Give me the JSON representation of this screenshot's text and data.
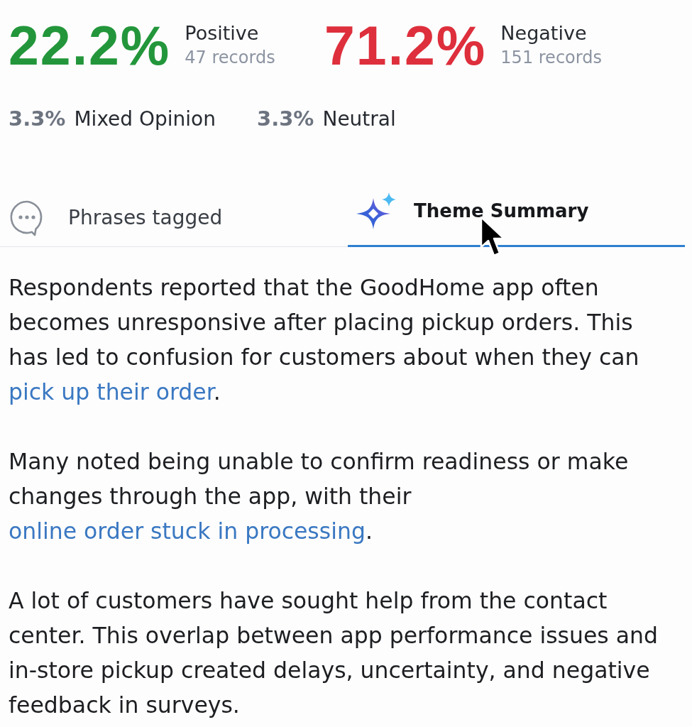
{
  "metrics": [
    {
      "value": "22.2%",
      "color": "#23963b",
      "label": "Positive",
      "records": "47 records"
    },
    {
      "value": "71.2%",
      "color": "#de2f3c",
      "label": "Negative",
      "records": "151 records"
    }
  ],
  "minor_metrics": [
    {
      "value": "3.3%",
      "label": "Mixed Opinion"
    },
    {
      "value": "3.3%",
      "label": "Neutral"
    }
  ],
  "tabs": [
    {
      "kind": "chat",
      "label": "Phrases tagged",
      "selected": false
    },
    {
      "kind": "sparkle",
      "label": "Theme Summary",
      "selected": true
    }
  ],
  "summary": [
    [
      {
        "kind": "text",
        "text": "Respondents reported that the GoodHome app often becomes unresponsive after placing pickup orders. This has led to confusion for customers about when they can "
      },
      {
        "kind": "link",
        "text": "pick up their order"
      },
      {
        "kind": "text",
        "text": "."
      }
    ],
    [
      {
        "kind": "text",
        "text": "Many noted being unable to confirm readiness or make changes through the app, with their "
      },
      {
        "kind": "link",
        "text": "online order stuck in processing"
      },
      {
        "kind": "text",
        "text": "."
      }
    ],
    [
      {
        "kind": "text",
        "text": "A lot of customers have sought help from the contact center. This overlap between app performance issues and in-store pickup created delays, uncertainty, and negative feedback in surveys."
      }
    ]
  ]
}
